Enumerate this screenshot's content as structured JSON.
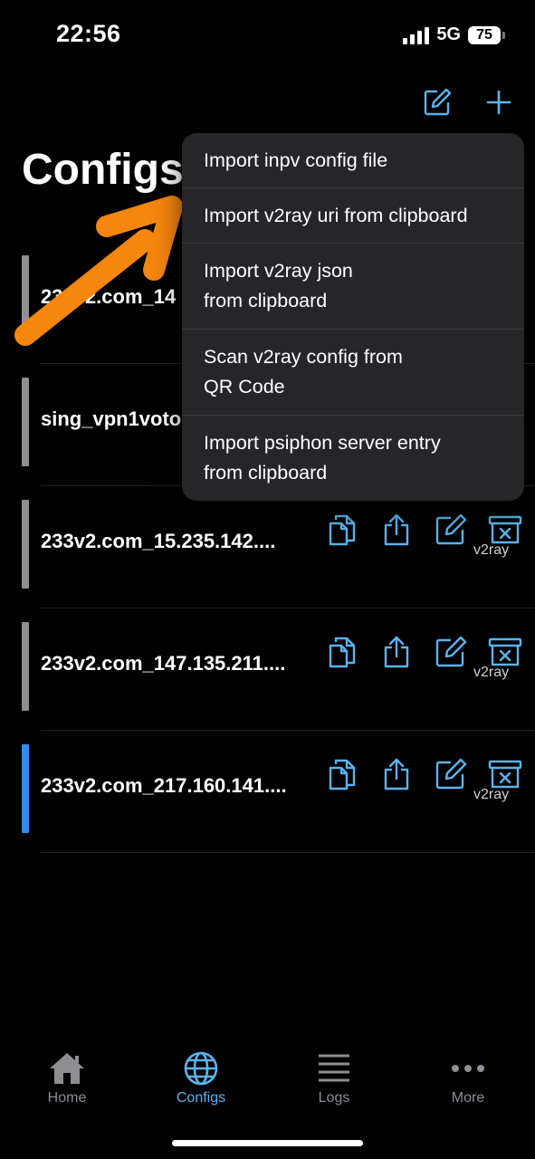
{
  "status": {
    "time": "22:56",
    "network": "5G",
    "battery": "75"
  },
  "nav": {
    "edit_icon": "edit-icon",
    "add_icon": "plus-icon"
  },
  "page": {
    "title": "Configs"
  },
  "configs": [
    {
      "name": "233v2.com_14",
      "type": "",
      "active": false
    },
    {
      "name": "sing_vpn1voto",
      "type": "",
      "active": false
    },
    {
      "name": "233v2.com_15.235.142....",
      "type": "v2ray",
      "active": false
    },
    {
      "name": "233v2.com_147.135.211....",
      "type": "v2ray",
      "active": false
    },
    {
      "name": "233v2.com_217.160.141....",
      "type": "v2ray",
      "active": true
    }
  ],
  "menu": {
    "items": [
      {
        "line1": "Import inpv config file",
        "line2": ""
      },
      {
        "line1": "Import v2ray uri from clipboard",
        "line2": ""
      },
      {
        "line1": "Import v2ray json",
        "line2": "from clipboard"
      },
      {
        "line1": "Scan v2ray config from",
        "line2": "QR Code"
      },
      {
        "line1": "Import psiphon server entry",
        "line2": "from clipboard"
      }
    ]
  },
  "tabs": [
    {
      "label": "Home",
      "icon": "house-icon",
      "active": false
    },
    {
      "label": "Configs",
      "icon": "globe-icon",
      "active": true
    },
    {
      "label": "Logs",
      "icon": "list-lines-icon",
      "active": false
    },
    {
      "label": "More",
      "icon": "ellipsis-icon",
      "active": false
    }
  ],
  "colors": {
    "accent": "#5ab4ef",
    "active_bar": "#2f8df0",
    "inactive_bar": "#8e8e93",
    "arrow": "#f5860e"
  }
}
